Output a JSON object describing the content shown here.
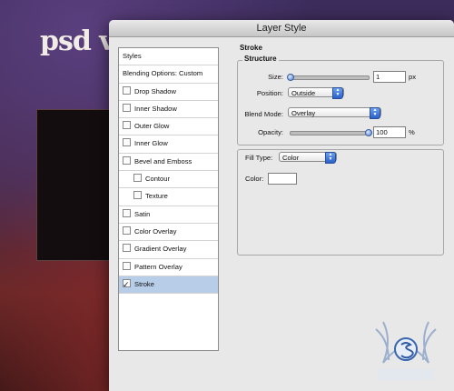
{
  "background": {
    "title": "psd v"
  },
  "dialog": {
    "title": "Layer Style",
    "styles_list": [
      {
        "label": "Styles",
        "checkbox": false,
        "checked": false,
        "sub": false,
        "selected": false
      },
      {
        "label": "Blending Options: Custom",
        "checkbox": false,
        "checked": false,
        "sub": false,
        "selected": false
      },
      {
        "label": "Drop Shadow",
        "checkbox": true,
        "checked": false,
        "sub": false,
        "selected": false
      },
      {
        "label": "Inner Shadow",
        "checkbox": true,
        "checked": false,
        "sub": false,
        "selected": false
      },
      {
        "label": "Outer Glow",
        "checkbox": true,
        "checked": false,
        "sub": false,
        "selected": false
      },
      {
        "label": "Inner Glow",
        "checkbox": true,
        "checked": false,
        "sub": false,
        "selected": false
      },
      {
        "label": "Bevel and Emboss",
        "checkbox": true,
        "checked": false,
        "sub": false,
        "selected": false
      },
      {
        "label": "Contour",
        "checkbox": true,
        "checked": false,
        "sub": true,
        "selected": false
      },
      {
        "label": "Texture",
        "checkbox": true,
        "checked": false,
        "sub": true,
        "selected": false
      },
      {
        "label": "Satin",
        "checkbox": true,
        "checked": false,
        "sub": false,
        "selected": false
      },
      {
        "label": "Color Overlay",
        "checkbox": true,
        "checked": false,
        "sub": false,
        "selected": false
      },
      {
        "label": "Gradient Overlay",
        "checkbox": true,
        "checked": false,
        "sub": false,
        "selected": false
      },
      {
        "label": "Pattern Overlay",
        "checkbox": true,
        "checked": false,
        "sub": false,
        "selected": false
      },
      {
        "label": "Stroke",
        "checkbox": true,
        "checked": true,
        "sub": false,
        "selected": true
      }
    ],
    "stroke": {
      "section_title": "Stroke",
      "structure_title": "Structure",
      "size_label": "Size:",
      "size_value": "1",
      "size_unit": "px",
      "position_label": "Position:",
      "position_value": "Outside",
      "blend_mode_label": "Blend Mode:",
      "blend_mode_value": "Overlay",
      "opacity_label": "Opacity:",
      "opacity_value": "100",
      "opacity_unit": "%",
      "opacity_level": 1.0,
      "size_level": 0.0,
      "fill_type_label": "Fill Type:",
      "fill_type_value": "Color",
      "color_label": "Color:",
      "color_value": "#ffffff"
    }
  }
}
